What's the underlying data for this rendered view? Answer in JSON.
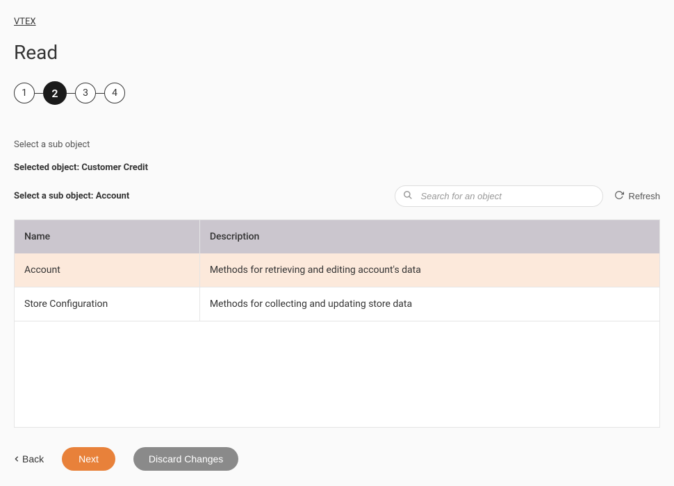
{
  "breadcrumb": {
    "label": "VTEX"
  },
  "page": {
    "title": "Read"
  },
  "stepper": {
    "steps": [
      "1",
      "2",
      "3",
      "4"
    ],
    "activeIndex": 1
  },
  "instruction": "Select a sub object",
  "selectedObject": {
    "label": "Selected object: Customer Credit"
  },
  "subSelect": {
    "label": "Select a sub object: Account"
  },
  "search": {
    "placeholder": "Search for an object"
  },
  "refresh": {
    "label": "Refresh"
  },
  "table": {
    "headers": {
      "name": "Name",
      "description": "Description"
    },
    "rows": [
      {
        "name": "Account",
        "description": "Methods for retrieving and editing account's data",
        "selected": true
      },
      {
        "name": "Store Configuration",
        "description": "Methods for collecting and updating store data",
        "selected": false
      }
    ]
  },
  "actions": {
    "back": "Back",
    "next": "Next",
    "discard": "Discard Changes"
  }
}
